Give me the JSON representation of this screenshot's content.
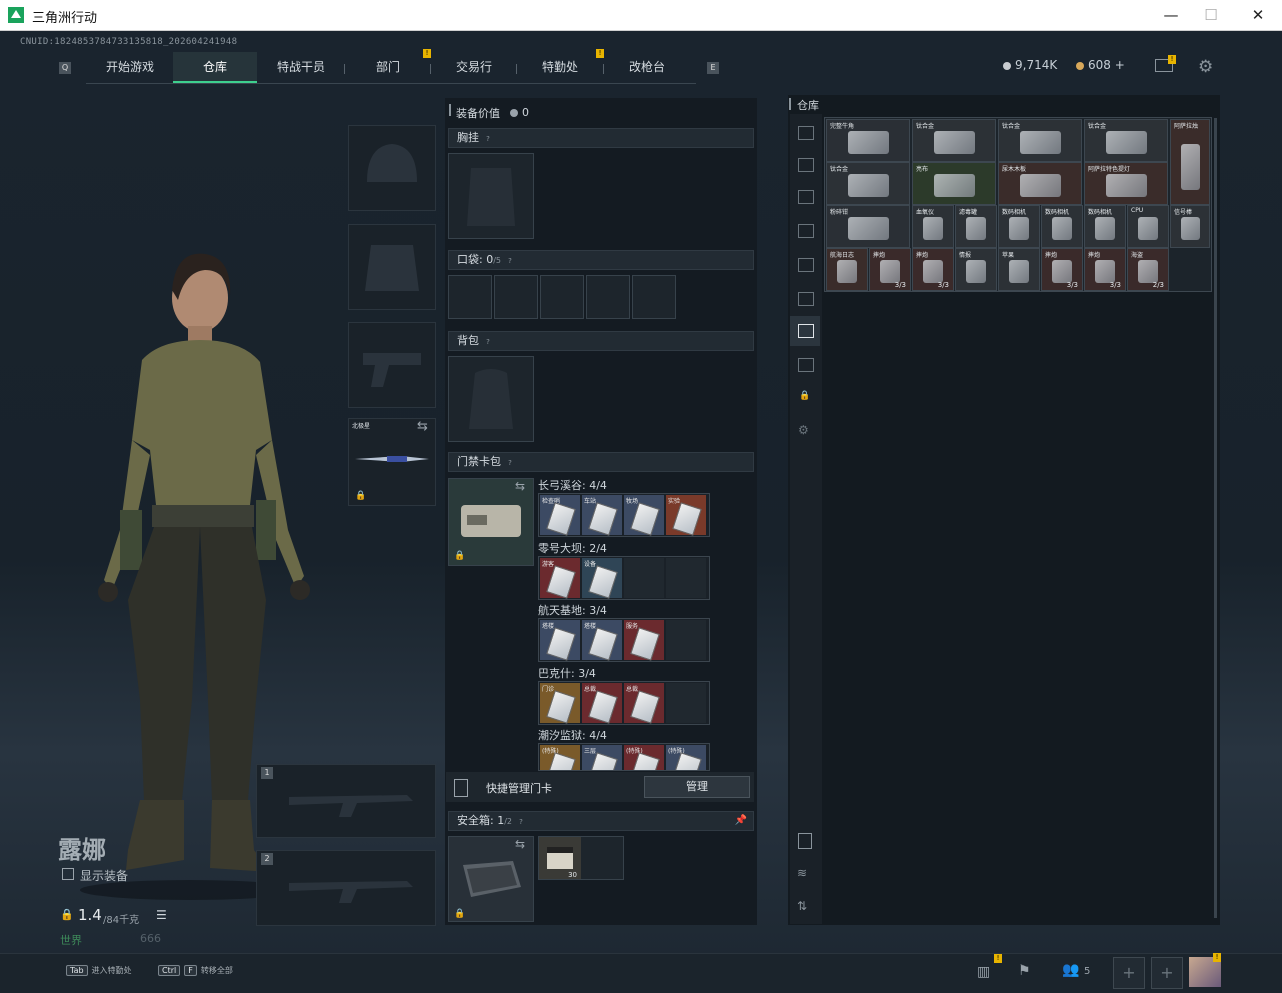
{
  "window": {
    "title": "三角洲行动",
    "minimize": "—",
    "maximize": "☐",
    "close": "✕"
  },
  "uid": "CNUID:1824853784733135818_202604241948",
  "nav": {
    "tabs": [
      "开始游戏",
      "仓库",
      "特战干员",
      "部门",
      "交易行",
      "特勤处",
      "改枪台"
    ],
    "active": 1,
    "left_key": "Q",
    "right_key": "E",
    "badge": "!"
  },
  "currency": {
    "primary": "9,714K",
    "secondary": "608 +",
    "primary_color": "#c8ccd0",
    "secondary_color": "#d8a85a"
  },
  "character": {
    "name": "露娜",
    "show_equipment_label": "显示装备",
    "weight_value": "1.4",
    "weight_unit": "/84千克",
    "world_record_label": "世界",
    "world_record_value": "666"
  },
  "weapon_slots": {
    "melee_label": "北极星",
    "primary_1": "1",
    "primary_2": "2"
  },
  "equipment": {
    "value_label": "装备价值",
    "value": "0",
    "chest_rig": "胸挂",
    "pockets_label": "口袋:",
    "pockets_value": "0",
    "pockets_max": "/5",
    "backpack": "背包",
    "keycard_bag": "门禁卡包",
    "help": "?"
  },
  "keycard_zones": [
    {
      "name": "长弓溪谷: 4/4",
      "cards": [
        "检查哨",
        "车站",
        "牧场",
        "实验"
      ],
      "colors": [
        "#3c4a63",
        "#3c4a63",
        "#3c4a63",
        "#7a3a2a"
      ]
    },
    {
      "name": "零号大坝: 2/4",
      "cards": [
        "游客",
        "设备"
      ],
      "colors": [
        "#6b2a2e",
        "#2f4556"
      ]
    },
    {
      "name": "航天基地: 3/4",
      "cards": [
        "塔楼",
        "塔楼",
        "服务"
      ],
      "colors": [
        "#3c4a63",
        "#3c4a63",
        "#6b2a2e"
      ]
    },
    {
      "name": "巴克什: 3/4",
      "cards": [
        "门诊",
        "总裁",
        "总裁"
      ],
      "colors": [
        "#7a5a2a",
        "#6b2a2e",
        "#6b2a2e"
      ]
    },
    {
      "name": "潮汐监狱: 4/4",
      "cards": [
        "(特殊)",
        "三层",
        "(特殊)",
        "(特殊)"
      ],
      "colors": [
        "#7a5a2a",
        "#3c4a63",
        "#6b2a2e",
        "#3c4a63"
      ]
    }
  ],
  "quick_manage": {
    "label": "快捷管理门卡",
    "button": "管理"
  },
  "safe_box": {
    "label": "安全箱:",
    "value": "1",
    "max": "/2",
    "item_count": "30"
  },
  "warehouse": {
    "title": "仓库",
    "items": [
      [
        {
          "label": "完整牛角",
          "count": "",
          "color": "#2a2f35"
        },
        {
          "label": "钛合金",
          "count": "",
          "color": "#2c3136"
        },
        {
          "label": "钛合金",
          "count": "",
          "color": "#2c3136"
        },
        {
          "label": "钛合金",
          "count": "",
          "color": "#2c3136"
        },
        {
          "label": "阿萨拉烛",
          "count": "",
          "color": "#3a2c2a"
        }
      ],
      [
        {
          "label": "钛合金",
          "count": "",
          "color": "#2c3136"
        },
        {
          "label": "亮布",
          "count": "",
          "color": "#2c3a2a"
        },
        {
          "label": "尿木木板",
          "count": "",
          "color": "#3a2c2a"
        },
        {
          "label": "阿萨拉特色提灯",
          "count": "",
          "color": "#3a2c2a"
        }
      ],
      [
        {
          "label": "粉碎钳",
          "count": "",
          "color": "#2a2f35"
        },
        {
          "label": "血氧仪",
          "count": "",
          "color": "#2c3136"
        },
        {
          "label": "滤毒罐",
          "count": "",
          "color": "#2c3136"
        },
        {
          "label": "数码相机",
          "count": "",
          "color": "#2c3136"
        },
        {
          "label": "数码相机",
          "count": "",
          "color": "#2c3136"
        },
        {
          "label": "数码相机",
          "count": "",
          "color": "#2c3136"
        },
        {
          "label": "CPU",
          "count": "",
          "color": "#2c3136"
        },
        {
          "label": "信号棒",
          "count": "",
          "color": "#2c3136"
        }
      ],
      [
        {
          "label": "航海日志",
          "count": "",
          "color": "#3a2c2a"
        },
        {
          "label": "摔炮",
          "count": "3/3",
          "color": "#3a2a2a"
        },
        {
          "label": "摔炮",
          "count": "3/3",
          "color": "#3a2a2a"
        },
        {
          "label": "情报",
          "count": "",
          "color": "#2c3136"
        },
        {
          "label": "苹果",
          "count": "",
          "color": "#2c3136"
        },
        {
          "label": "摔炮",
          "count": "3/3",
          "color": "#3a2a2a"
        },
        {
          "label": "摔炮",
          "count": "3/3",
          "color": "#3a2a2a"
        },
        {
          "label": "海盗",
          "count": "2/3",
          "color": "#3a2a2a"
        }
      ]
    ]
  },
  "bottom": {
    "hint1_key": "Tab",
    "hint1": "进入特勤处",
    "hint2_key1": "Ctrl",
    "hint2_key2": "F",
    "hint2": "转移全部",
    "friends_count": "5",
    "badge": "!"
  }
}
